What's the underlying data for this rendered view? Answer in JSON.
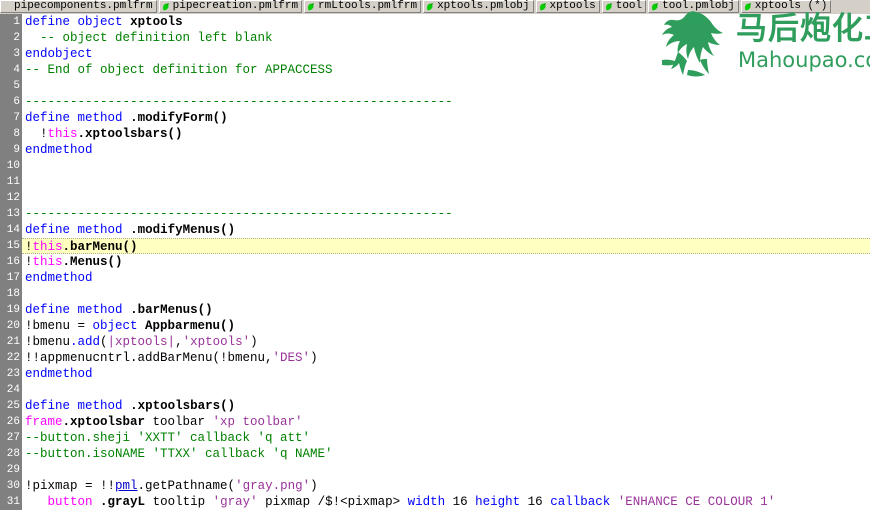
{
  "tabbar": {
    "tabs": [
      {
        "label": "pipecomponents.pmlfrm",
        "icon": "pml-file-icon",
        "active": false,
        "has_icon": false
      },
      {
        "label": "pipecreation.pmlfrm",
        "icon": "pml-file-icon",
        "active": false,
        "has_icon": true
      },
      {
        "label": "rmLtools.pmlfrm",
        "icon": "pml-file-icon",
        "active": false,
        "has_icon": true
      },
      {
        "label": "xptools.pmlobj",
        "icon": "pml-file-icon",
        "active": false,
        "has_icon": true
      },
      {
        "label": "xptools",
        "icon": "pml-file-icon",
        "active": false,
        "has_icon": true
      },
      {
        "label": "tool",
        "icon": "pml-file-icon",
        "active": false,
        "has_icon": true
      },
      {
        "label": "tool.pmlobj",
        "icon": "pml-file-icon",
        "active": false,
        "has_icon": true
      },
      {
        "label": "xptools (*)",
        "icon": "pml-file-icon",
        "active": true,
        "has_icon": true
      }
    ]
  },
  "editor": {
    "current_line": 15,
    "lines": [
      {
        "n": "1",
        "tokens": [
          {
            "t": "define",
            "c": "kw"
          },
          {
            "t": " ",
            "c": "pln"
          },
          {
            "t": "object",
            "c": "kw"
          },
          {
            "t": " ",
            "c": "pln"
          },
          {
            "t": "xptools",
            "c": "id"
          }
        ]
      },
      {
        "n": "2",
        "tokens": [
          {
            "t": "  -- object definition left blank",
            "c": "cmt"
          }
        ]
      },
      {
        "n": "3",
        "tokens": [
          {
            "t": "endobject",
            "c": "kw"
          }
        ]
      },
      {
        "n": "4",
        "tokens": [
          {
            "t": "-- End of object definition for APPACCESS",
            "c": "cmt"
          }
        ]
      },
      {
        "n": "5",
        "tokens": [
          {
            "t": "",
            "c": "pln"
          }
        ]
      },
      {
        "n": "6",
        "tokens": [
          {
            "t": "---------------------------------------------------------",
            "c": "cmt"
          }
        ]
      },
      {
        "n": "7",
        "tokens": [
          {
            "t": "define",
            "c": "kw"
          },
          {
            "t": " ",
            "c": "pln"
          },
          {
            "t": "method",
            "c": "kw"
          },
          {
            "t": " ",
            "c": "pln"
          },
          {
            "t": ".modifyForm()",
            "c": "id"
          }
        ]
      },
      {
        "n": "8",
        "tokens": [
          {
            "t": "  !",
            "c": "pln"
          },
          {
            "t": "this",
            "c": "mag"
          },
          {
            "t": ".xptoolsbars()",
            "c": "id"
          }
        ]
      },
      {
        "n": "9",
        "tokens": [
          {
            "t": "endmethod",
            "c": "kw"
          }
        ]
      },
      {
        "n": "10",
        "tokens": [
          {
            "t": "",
            "c": "pln"
          }
        ]
      },
      {
        "n": "11",
        "tokens": [
          {
            "t": "",
            "c": "pln"
          }
        ]
      },
      {
        "n": "12",
        "tokens": [
          {
            "t": "",
            "c": "pln"
          }
        ]
      },
      {
        "n": "13",
        "tokens": [
          {
            "t": "---------------------------------------------------------",
            "c": "cmt"
          }
        ]
      },
      {
        "n": "14",
        "tokens": [
          {
            "t": "define",
            "c": "kw"
          },
          {
            "t": " ",
            "c": "pln"
          },
          {
            "t": "method",
            "c": "kw"
          },
          {
            "t": " ",
            "c": "pln"
          },
          {
            "t": ".modifyMenus()",
            "c": "id"
          }
        ]
      },
      {
        "n": "15",
        "tokens": [
          {
            "t": "!",
            "c": "pln"
          },
          {
            "t": "this",
            "c": "mag"
          },
          {
            "t": ".barMenu()",
            "c": "id"
          }
        ]
      },
      {
        "n": "16",
        "tokens": [
          {
            "t": "!",
            "c": "pln"
          },
          {
            "t": "this",
            "c": "mag"
          },
          {
            "t": ".Menus()",
            "c": "id"
          }
        ]
      },
      {
        "n": "17",
        "tokens": [
          {
            "t": "endmethod",
            "c": "kw"
          }
        ]
      },
      {
        "n": "18",
        "tokens": [
          {
            "t": "",
            "c": "pln"
          }
        ]
      },
      {
        "n": "19",
        "tokens": [
          {
            "t": "define",
            "c": "kw"
          },
          {
            "t": " ",
            "c": "pln"
          },
          {
            "t": "method",
            "c": "kw"
          },
          {
            "t": " ",
            "c": "pln"
          },
          {
            "t": ".barMenus()",
            "c": "id"
          }
        ]
      },
      {
        "n": "20",
        "tokens": [
          {
            "t": "!bmenu = ",
            "c": "pln"
          },
          {
            "t": "object",
            "c": "kw"
          },
          {
            "t": " ",
            "c": "pln"
          },
          {
            "t": "Appbarmenu()",
            "c": "id"
          }
        ]
      },
      {
        "n": "21",
        "tokens": [
          {
            "t": "!bmenu",
            "c": "pln"
          },
          {
            "t": ".add",
            "c": "kw"
          },
          {
            "t": "(",
            "c": "pln"
          },
          {
            "t": "|xptools|",
            "c": "bar"
          },
          {
            "t": ",",
            "c": "pln"
          },
          {
            "t": "'xptools'",
            "c": "str"
          },
          {
            "t": ")",
            "c": "pln"
          }
        ]
      },
      {
        "n": "22",
        "tokens": [
          {
            "t": "!!appmenucntrl.addBarMenu(!bmenu,",
            "c": "pln"
          },
          {
            "t": "'DES'",
            "c": "str"
          },
          {
            "t": ")",
            "c": "pln"
          }
        ]
      },
      {
        "n": "23",
        "tokens": [
          {
            "t": "endmethod",
            "c": "kw"
          }
        ]
      },
      {
        "n": "24",
        "tokens": [
          {
            "t": "",
            "c": "pln"
          }
        ]
      },
      {
        "n": "25",
        "tokens": [
          {
            "t": "define",
            "c": "kw"
          },
          {
            "t": " ",
            "c": "pln"
          },
          {
            "t": "method",
            "c": "kw"
          },
          {
            "t": " ",
            "c": "pln"
          },
          {
            "t": ".xptoolsbars()",
            "c": "id"
          }
        ]
      },
      {
        "n": "26",
        "tokens": [
          {
            "t": "frame",
            "c": "mag"
          },
          {
            "t": ".xptoolsbar",
            "c": "id"
          },
          {
            "t": " toolbar ",
            "c": "pln"
          },
          {
            "t": "'xp toolbar'",
            "c": "str"
          }
        ]
      },
      {
        "n": "27",
        "tokens": [
          {
            "t": "--button.sheji 'XXTT' callback 'q att'",
            "c": "cmt"
          }
        ]
      },
      {
        "n": "28",
        "tokens": [
          {
            "t": "--button.isoNAME 'TTXX' callback 'q NAME'",
            "c": "cmt"
          }
        ]
      },
      {
        "n": "29",
        "tokens": [
          {
            "t": "",
            "c": "pln"
          }
        ]
      },
      {
        "n": "30",
        "tokens": [
          {
            "t": "!pixmap = !!",
            "c": "pln"
          },
          {
            "t": "pml",
            "c": "link"
          },
          {
            "t": ".getPathname(",
            "c": "pln"
          },
          {
            "t": "'gray.png'",
            "c": "str"
          },
          {
            "t": ")",
            "c": "pln"
          }
        ]
      },
      {
        "n": "31",
        "tokens": [
          {
            "t": "   ",
            "c": "pln"
          },
          {
            "t": "button",
            "c": "mag"
          },
          {
            "t": " ",
            "c": "pln"
          },
          {
            "t": ".grayL",
            "c": "id"
          },
          {
            "t": " tooltip ",
            "c": "pln"
          },
          {
            "t": "'gray'",
            "c": "str"
          },
          {
            "t": " pixmap /$!<pixmap> ",
            "c": "pln"
          },
          {
            "t": "width",
            "c": "kw"
          },
          {
            "t": " 16 ",
            "c": "pln"
          },
          {
            "t": "height",
            "c": "kw"
          },
          {
            "t": " 16 ",
            "c": "pln"
          },
          {
            "t": "callback",
            "c": "kw"
          },
          {
            "t": " ",
            "c": "pln"
          },
          {
            "t": "'ENHANCE CE COLOUR 1'",
            "c": "str"
          }
        ]
      }
    ]
  },
  "watermark": {
    "chinese_text": "马后炮化工",
    "site_text": "Mahoupao.com",
    "color": "#2f9e5c",
    "logo": "horse-logo-icon"
  }
}
